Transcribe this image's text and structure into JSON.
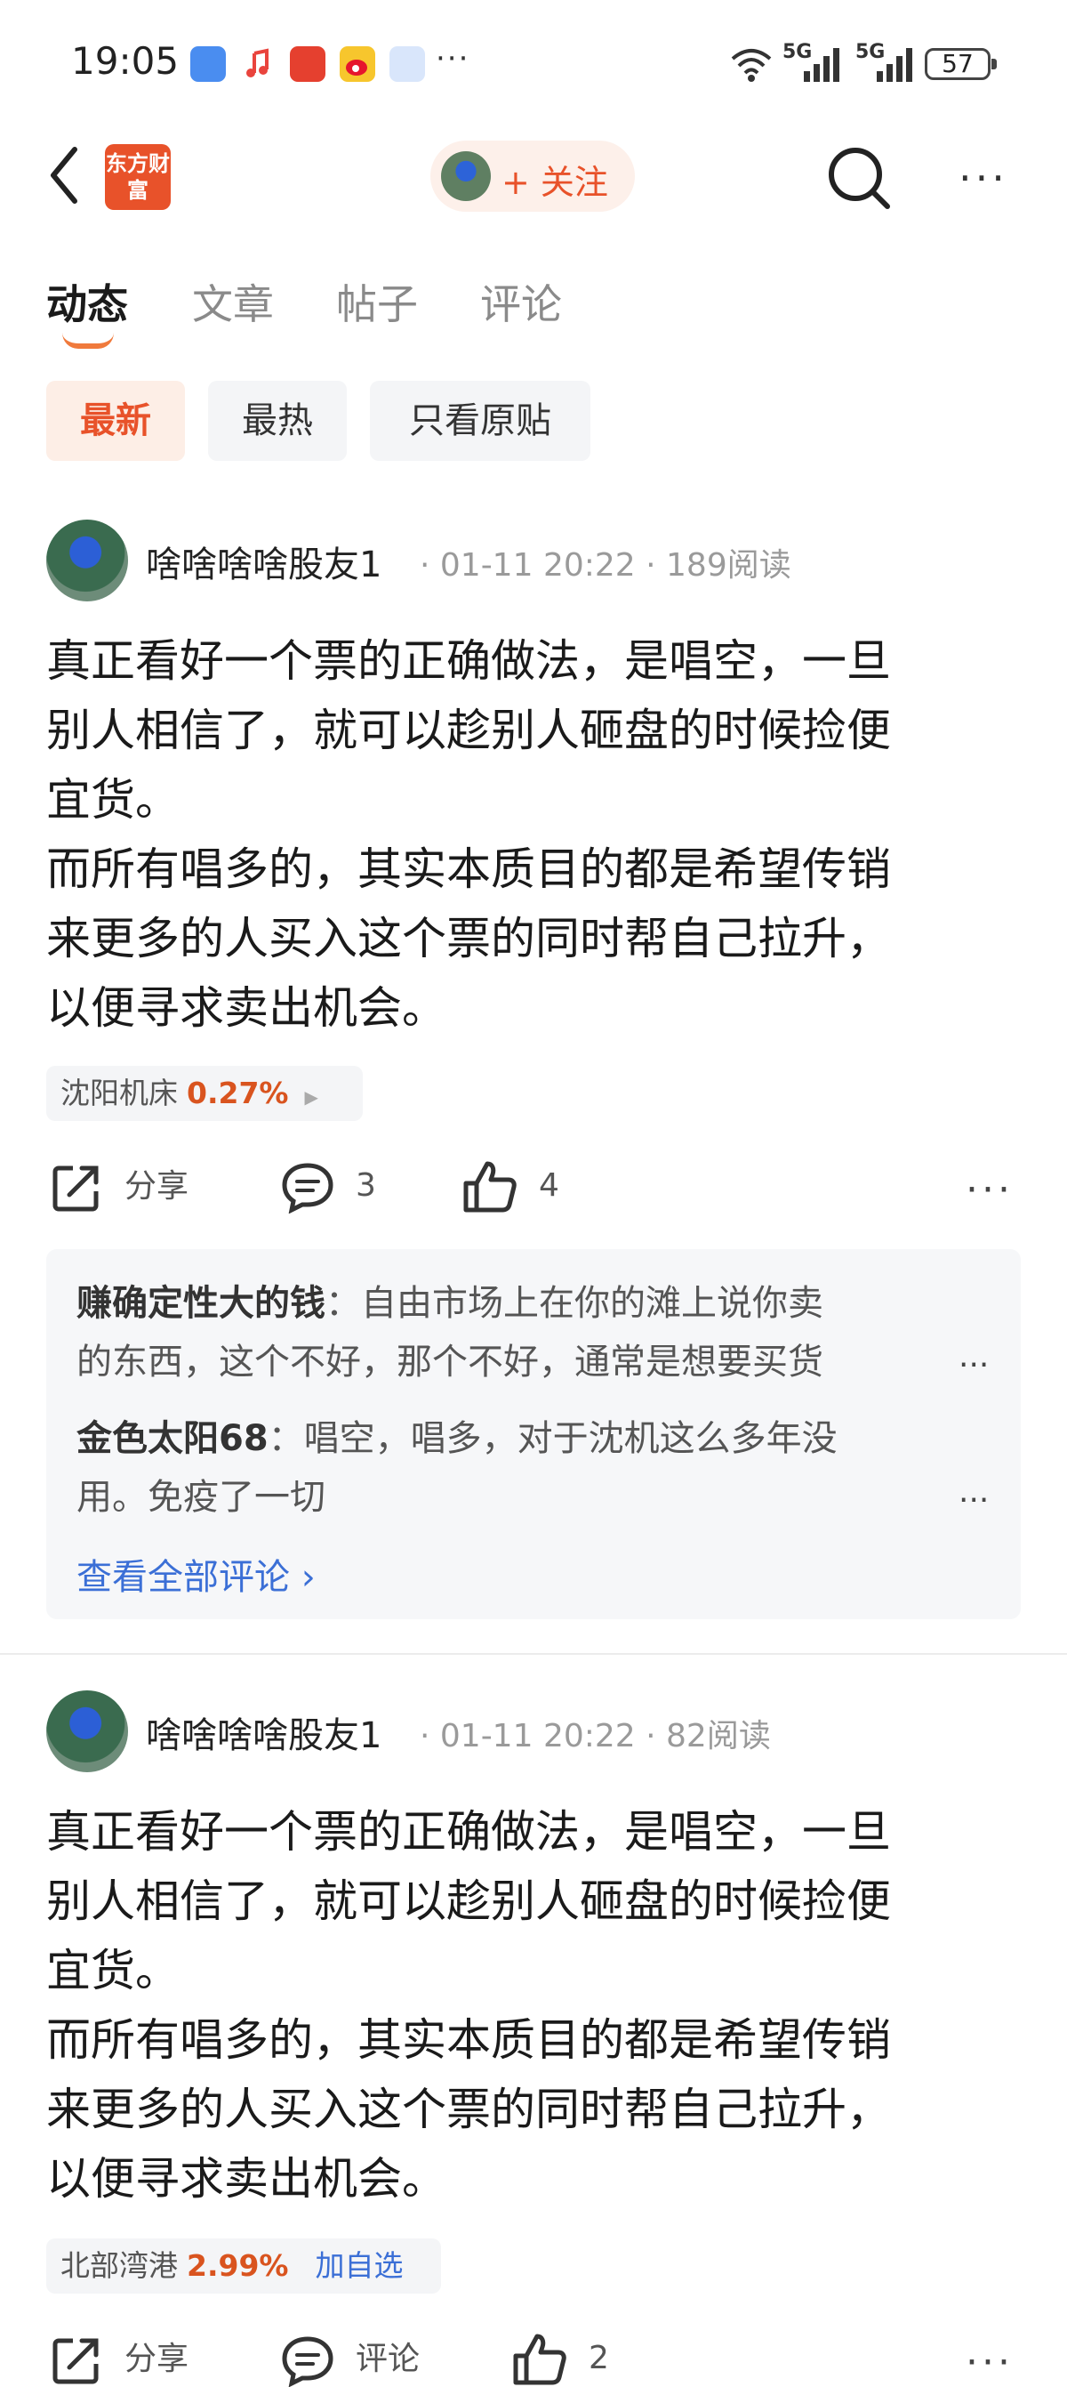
{
  "status_bar": {
    "time": "19:05",
    "dots": "···",
    "network_1": "5G",
    "network_2": "5G",
    "battery": "57",
    "app_icons": [
      "cloud-app-icon",
      "music-icon",
      "shopping-app-icon",
      "weibo-icon",
      "cloud-face-icon"
    ]
  },
  "header": {
    "logo_text": "东方财富",
    "follow_label": "+ 关注"
  },
  "tabs": [
    {
      "label": "动态",
      "active": true
    },
    {
      "label": "文章",
      "active": false
    },
    {
      "label": "帖子",
      "active": false
    },
    {
      "label": "评论",
      "active": false
    }
  ],
  "filters": [
    {
      "label": "最新",
      "active": true
    },
    {
      "label": "最热",
      "active": false
    },
    {
      "label": "只看原贴",
      "active": false
    }
  ],
  "posts": [
    {
      "author": "啥啥啥啥股友1",
      "meta": "· 01-11 20:22 · 189阅读",
      "lines": [
        "真正看好一个票的正确做法，是唱空，一旦",
        "别人相信了，就可以趁别人砸盘的时候捡便",
        "宜货。",
        "而所有唱多的，其实本质目的都是希望传销",
        "来更多的人买入这个票的同时帮自己拉升，",
        "以便寻求卖出机会。"
      ],
      "stock": {
        "name": "沈阳机床",
        "change": "0.27%",
        "arrow": "▶"
      },
      "actions": {
        "share": "分享",
        "comments": "3",
        "likes": "4"
      },
      "comments": [
        {
          "user": "赚确定性大的钱",
          "line1": "：自由市场上在你的滩上说你卖",
          "line2": "的东西，这个不好，那个不好，通常是想要买货"
        },
        {
          "user": "金色太阳68",
          "line1": "：唱空，唱多，对于沈机这么多年没",
          "line2": "用。免疫了一切"
        }
      ],
      "view_all": "查看全部评论 ›"
    },
    {
      "author": "啥啥啥啥股友1",
      "meta": "· 01-11 20:22 · 82阅读",
      "lines": [
        "真正看好一个票的正确做法，是唱空，一旦",
        "别人相信了，就可以趁别人砸盘的时候捡便",
        "宜货。",
        "而所有唱多的，其实本质目的都是希望传销",
        "来更多的人买入这个票的同时帮自己拉升，",
        "以便寻求卖出机会。"
      ],
      "stock": {
        "name": "北部湾港",
        "change": "2.99%",
        "add": "加自选"
      },
      "actions": {
        "share": "分享",
        "comments": "评论",
        "likes": "2"
      }
    }
  ],
  "more_glyph": "···",
  "comment_ellipsis": "..."
}
